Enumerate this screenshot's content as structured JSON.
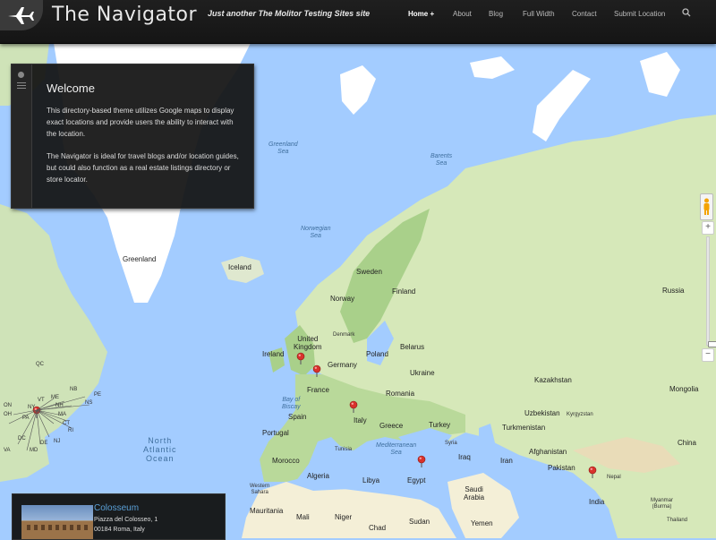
{
  "header": {
    "site_title": "The Navigator",
    "tagline": "Just another The Molitor Testing Sites site",
    "logo_icon": "airplane-icon",
    "nav": [
      {
        "label": "Home +",
        "active": true
      },
      {
        "label": "About",
        "active": false
      },
      {
        "label": "Blog",
        "active": false
      },
      {
        "label": "Full Width",
        "active": false
      },
      {
        "label": "Contact",
        "active": false
      },
      {
        "label": "Submit Location",
        "active": false
      }
    ],
    "search_icon": "search-icon"
  },
  "welcome": {
    "title": "Welcome",
    "paragraph1": "This directory-based theme utilizes Google maps to display exact locations and provide users the ability to interact with the location.",
    "paragraph2": "The Navigator is ideal for travel blogs and/or location guides, but could also function as a real estate listings directory or store locator."
  },
  "map": {
    "seas": [
      {
        "key": "greenland_sea",
        "text": "Greenland\nSea"
      },
      {
        "key": "barents_sea",
        "text": "Barents\nSea"
      },
      {
        "key": "norwegian_sea",
        "text": "Norwegian\nSea"
      },
      {
        "key": "north_atlantic",
        "text": "North\nAtlantic\nOcean"
      },
      {
        "key": "bay_biscay",
        "text": "Bay of\nBiscay"
      },
      {
        "key": "mediterranean",
        "text": "Mediterranean\nSea"
      }
    ],
    "labels": {
      "greenland": "Greenland",
      "iceland": "Iceland",
      "sweden": "Sweden",
      "norway": "Norway",
      "finland": "Finland",
      "russia": "Russia",
      "uk": "United\nKingdom",
      "ireland": "Ireland",
      "denmark": "Denmark",
      "poland": "Poland",
      "belarus": "Belarus",
      "germany": "Germany",
      "ukraine": "Ukraine",
      "france": "France",
      "romania": "Romania",
      "spain": "Spain",
      "portugal": "Portugal",
      "italy": "Italy",
      "greece": "Greece",
      "turkey": "Turkey",
      "kazakhstan": "Kazakhstan",
      "mongolia": "Mongolia",
      "uzbekistan": "Uzbekistan",
      "kyrgyzstan": "Kyrgyzstan",
      "turkmenistan": "Turkmenistan",
      "afghanistan": "Afghanistan",
      "pakistan": "Pakistan",
      "china": "China",
      "nepal": "Nepal",
      "india": "India",
      "iran": "Iran",
      "iraq": "Iraq",
      "syria": "Syria",
      "saudi": "Saudi\nArabia",
      "egypt": "Egypt",
      "libya": "Libya",
      "algeria": "Algeria",
      "morocco": "Morocco",
      "tunisia": "Tunisia",
      "western_sahara": "Western\nSahara",
      "mauritania": "Mauritania",
      "mali": "Mali",
      "niger": "Niger",
      "chad": "Chad",
      "sudan": "Sudan",
      "yemen": "Yemen",
      "myanmar": "Myanmar\n(Burma)",
      "thailand": "Thailand",
      "qc": "QC",
      "nb": "NB",
      "me": "ME",
      "nh": "NH",
      "pe": "PE",
      "ns": "NS",
      "vt": "VT",
      "ny": "NY",
      "ma": "MA",
      "ct": "CT",
      "ri": "RI",
      "pa": "PA",
      "nj": "NJ",
      "md": "MD",
      "de": "DE",
      "va": "VA",
      "oh": "OH",
      "mi": "MI",
      "in": "IN",
      "ky": "KY",
      "wv": "WV",
      "nc": "NC",
      "sc": "SC",
      "tn": "TN",
      "il": "IL",
      "ms": "MS",
      "on": "ON",
      "dc": "DC"
    },
    "pin_color": "#d9322c"
  },
  "controls": {
    "pegman_icon": "pegman-icon",
    "zoom_in": "+",
    "zoom_out": "−"
  },
  "card": {
    "title": "Colosseum",
    "address1": "Piazza del Colosseo, 1",
    "address2": "00184 Roma, Italy"
  }
}
